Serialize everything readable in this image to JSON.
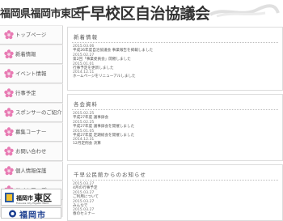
{
  "header": {
    "prefecture_city": "福岡県福岡市東区",
    "site_title": "千早校区自治協議会"
  },
  "sidebar": {
    "items": [
      {
        "label": "トップページ"
      },
      {
        "label": "新着情報"
      },
      {
        "label": "イベント情報"
      },
      {
        "label": "行事予定"
      },
      {
        "label": "スポンサーのご紹介"
      },
      {
        "label": "募集コーナー"
      },
      {
        "label": "お問い合わせ"
      },
      {
        "label": "個人情報保護"
      },
      {
        "label": "サイトマップ"
      }
    ],
    "banner_higashi": {
      "city": "福岡市",
      "ward": "東区",
      "en": "Fukuoka City Higashi Ward"
    },
    "banner_fukuoka": {
      "text": "福岡市"
    }
  },
  "panels": [
    {
      "title": "新着情報",
      "entries": [
        {
          "date": "2015.03.06",
          "title": "平成26年度自治協議会 事業報告を掲載しました"
        },
        {
          "date": "2015.02.27",
          "title": "第2回「事業委員会」開催しました"
        },
        {
          "date": "2015.01.01",
          "title": "行事予定を更新しました"
        },
        {
          "date": "2014.12.11",
          "title": "ホームページをリニューアルしました"
        }
      ]
    },
    {
      "title": "各会資料",
      "entries": [
        {
          "date": "2015.02.25",
          "title": "平成27年度 議事録会"
        },
        {
          "date": "2015.02.25",
          "title": "平成27年度 議事録会を開催しました"
        },
        {
          "date": "2015.01.05",
          "title": "平成27年度 定期総会を開催しました"
        },
        {
          "date": "2014.12.31",
          "title": "12月定例会 決算"
        }
      ]
    },
    {
      "title": "千早公民館からのお知らせ",
      "entries": [
        {
          "date": "2015.03.27",
          "title": "4月の行事予定"
        },
        {
          "date": "2015.03.27",
          "title": "ご利用について"
        },
        {
          "date": "2015.03.27",
          "title": "みんなで "
        },
        {
          "date": "2015.03.27",
          "title": "春のセミナー"
        }
      ]
    }
  ],
  "colors": {
    "accent_pink": "#e87ab3",
    "sidebar_bg": "#ebeaea",
    "nav_bg": "#fbfbfb"
  },
  "icons": {
    "nav": "flower-icon",
    "banner": "higashi-logo-icon",
    "header": "brush-decoration-icon"
  }
}
